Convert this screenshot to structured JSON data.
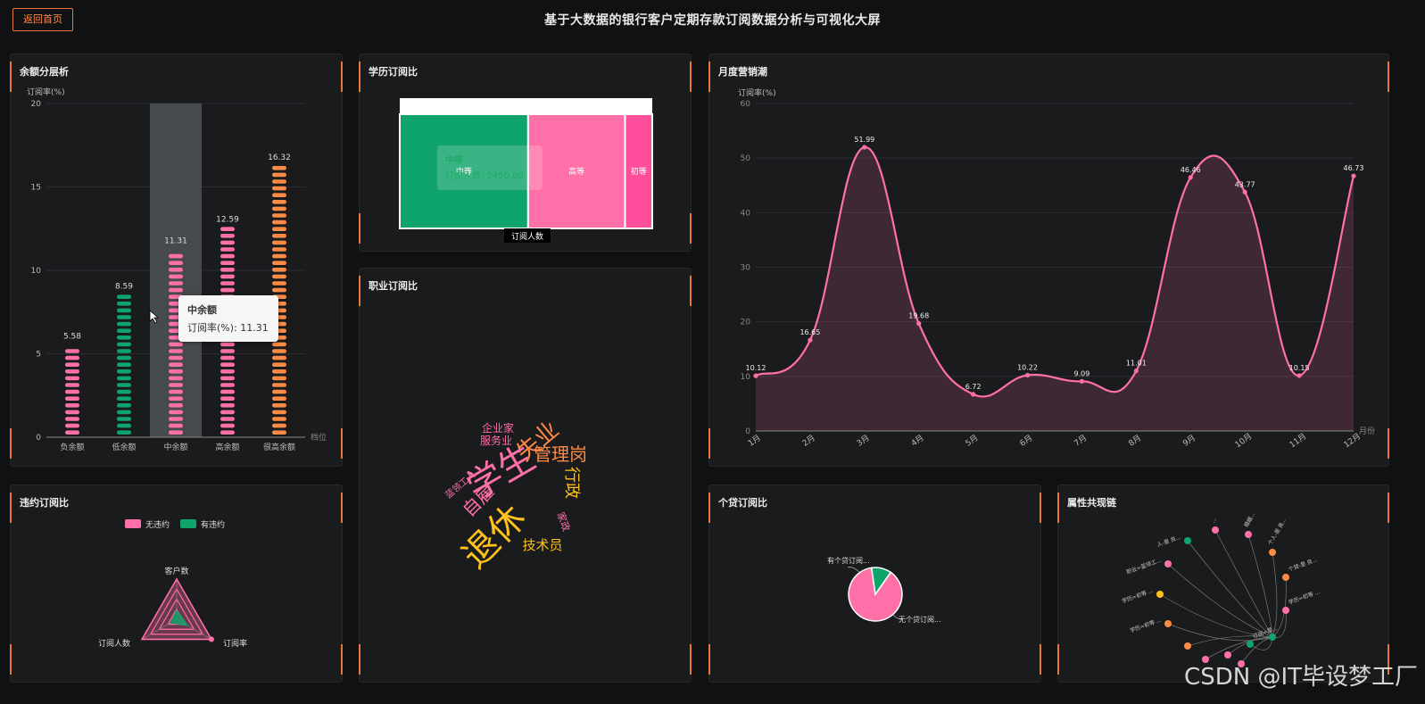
{
  "header": {
    "back_label": "返回首页",
    "title": "基于大数据的银行客户定期存款订阅数据分析与可视化大屏"
  },
  "panels": {
    "balance": "余额分层析",
    "education": "学历订阅比",
    "job": "职业订阅比",
    "monthly": "月度营销潮",
    "default": "违约订阅比",
    "loan": "个贷订阅比",
    "attr": "属性共现链"
  },
  "watermark": "CSDN @IT毕设梦工厂",
  "chart_data": [
    {
      "id": "balance",
      "type": "bar",
      "ylabel": "订阅率(%)",
      "xlabel": "档位",
      "ylim": [
        0,
        20
      ],
      "yticks": [
        0,
        5,
        10,
        15,
        20
      ],
      "categories": [
        "负余额",
        "低余额",
        "中余额",
        "高余额",
        "很高余额"
      ],
      "values": [
        5.58,
        8.59,
        11.31,
        12.59,
        16.32
      ],
      "colors": [
        "#ff6fa8",
        "#0fa46b",
        "#ff6fa8",
        "#ff6fa8",
        "#ff8a45"
      ],
      "highlight_index": 2,
      "tooltip": {
        "title": "中余额",
        "label": "订阅率(%)",
        "value": "11.31"
      }
    },
    {
      "id": "education",
      "type": "treemap",
      "legend": "订阅人数",
      "items": [
        {
          "name": "中等",
          "value": 2450,
          "color": "#0fa46b"
        },
        {
          "name": "高等",
          "value": 1850,
          "color": "#ff6fa8"
        },
        {
          "name": "初等",
          "value": 520,
          "color": "#ff4f9c"
        }
      ],
      "tooltip": {
        "title": "中等",
        "label": "订阅人数",
        "value": "2450.00"
      }
    },
    {
      "id": "job",
      "type": "wordcloud",
      "words": [
        {
          "text": "退休",
          "weight": 10,
          "color": "#ffc21a",
          "rotate": -45
        },
        {
          "text": "失业",
          "weight": 8,
          "color": "#ff8a45",
          "rotate": -40
        },
        {
          "text": "学生",
          "weight": 7,
          "color": "#ff6fa8",
          "rotate": -30
        },
        {
          "text": "管理岗",
          "weight": 6,
          "color": "#ff8a45",
          "rotate": 0
        },
        {
          "text": "行政",
          "weight": 5,
          "color": "#ffc21a",
          "rotate": 90
        },
        {
          "text": "技术员",
          "weight": 5,
          "color": "#ffc21a",
          "rotate": 0
        },
        {
          "text": "自雇",
          "weight": 4,
          "color": "#ff6fa8",
          "rotate": -45
        },
        {
          "text": "企业家",
          "weight": 3,
          "color": "#ff6fa8",
          "rotate": 0
        },
        {
          "text": "服务业",
          "weight": 3,
          "color": "#ff6fa8",
          "rotate": 0
        },
        {
          "text": "蓝领工人",
          "weight": 2,
          "color": "#ff6fa8",
          "rotate": -40
        },
        {
          "text": "家政",
          "weight": 2,
          "color": "#ff6fa8",
          "rotate": 70
        }
      ]
    },
    {
      "id": "monthly",
      "type": "area",
      "ylabel": "订阅率(%)",
      "xlabel": "月份",
      "ylim": [
        0,
        60
      ],
      "yticks": [
        0,
        10,
        20,
        30,
        40,
        50,
        60
      ],
      "categories": [
        "1月",
        "2月",
        "3月",
        "4月",
        "5月",
        "6月",
        "7月",
        "8月",
        "9月",
        "10月",
        "11月",
        "12月"
      ],
      "values": [
        10.12,
        16.65,
        51.99,
        19.68,
        6.72,
        10.22,
        9.09,
        11.01,
        46.46,
        43.77,
        10.15,
        46.73
      ],
      "labels": [
        "10.12",
        "16.65",
        "51.99",
        "19.68",
        "6.72",
        "10.22",
        "9.09",
        "11.01",
        "46.46",
        "43.77",
        "10.15",
        "46.73"
      ],
      "color": "#ff6fa8"
    },
    {
      "id": "default",
      "type": "radar",
      "legend": [
        {
          "name": "无违约",
          "color": "#ff6fa8"
        },
        {
          "name": "有违约",
          "color": "#0fa46b"
        }
      ],
      "indicators": [
        "客户数",
        "订阅率",
        "订阅人数"
      ]
    },
    {
      "id": "loan",
      "type": "pie",
      "slices": [
        {
          "name": "无个贷订阅...",
          "value": 88,
          "color": "#ff6fa8"
        },
        {
          "name": "有个贷订阅...",
          "value": 12,
          "color": "#0fa46b"
        }
      ]
    },
    {
      "id": "attr",
      "type": "graph",
      "nodes": [
        {
          "label": "人-是 良...",
          "color": "#0fa46b"
        },
        {
          "label": "...",
          "color": "#ff6fa8"
        },
        {
          "label": "婚姻...",
          "color": "#ff6fa8"
        },
        {
          "label": "个人-是 良...",
          "color": "#ff8a45"
        },
        {
          "label": "个贷-是 良...",
          "color": "#ff8a45"
        },
        {
          "label": "学历=初等 ...",
          "color": "#ff6fa8"
        },
        {
          "label": "职业=蓝领工...",
          "color": "#ff6fa8"
        },
        {
          "label": "学历=初等 ...",
          "color": "#ffc21a"
        },
        {
          "label": "学历=初等 ...",
          "color": "#ff8a45"
        },
        {
          "label": "订阅=是...",
          "color": "#0fa46b"
        }
      ]
    }
  ]
}
